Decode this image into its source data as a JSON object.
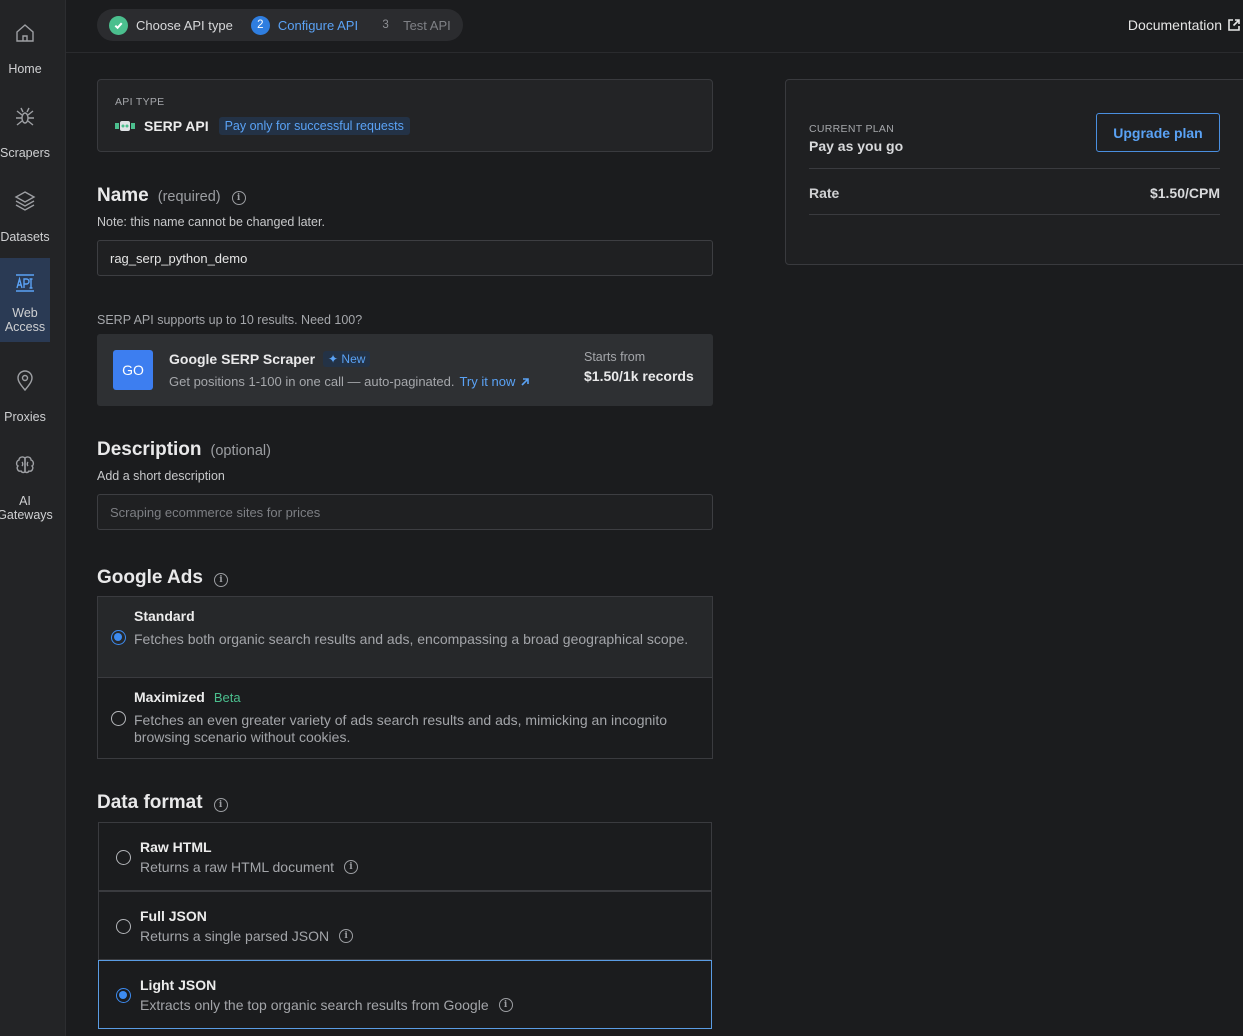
{
  "sidebar": {
    "items": [
      {
        "label": "Home",
        "icon": "home-icon"
      },
      {
        "label": "Scrapers",
        "icon": "spider-icon"
      },
      {
        "label": "Datasets",
        "icon": "layers-icon"
      },
      {
        "label": "Web\nAccess",
        "icon": "api-icon",
        "active": true
      },
      {
        "label": "Proxies",
        "icon": "location-pin-icon"
      },
      {
        "label": "AI\nGateways",
        "icon": "brain-icon"
      }
    ]
  },
  "stepper": {
    "steps": [
      {
        "number": "",
        "label": "Choose API type",
        "state": "done"
      },
      {
        "number": "2",
        "label": "Configure API",
        "state": "current"
      },
      {
        "number": "3",
        "label": "Test API",
        "state": "todo"
      }
    ]
  },
  "header": {
    "documentation": "Documentation"
  },
  "api_type": {
    "label": "API TYPE",
    "name": "SERP API",
    "badge": "Pay only for successful requests"
  },
  "name_section": {
    "title": "Name",
    "sub": "(required)",
    "note": "Note: this name cannot be changed later.",
    "value": "rag_serp_python_demo"
  },
  "promo": {
    "supports": "SERP API supports up to 10 results. Need 100?",
    "logo_text": "GO",
    "title": "Google SERP Scraper",
    "new_badge": "New",
    "desc": "Get positions 1-100 in one call — auto-paginated.",
    "try_link": "Try it now",
    "starts_from": "Starts from",
    "price": "$1.50/1k records"
  },
  "description_section": {
    "title": "Description",
    "sub": "(optional)",
    "note": "Add a short description",
    "placeholder": "Scraping ecommerce sites for prices"
  },
  "google_ads": {
    "title": "Google Ads",
    "options": [
      {
        "title": "Standard",
        "tag": "",
        "desc": "Fetches both organic search results and ads, encompassing a broad geographical scope.",
        "selected": true
      },
      {
        "title": "Maximized",
        "tag": "Beta",
        "desc": "Fetches an even greater variety of ads search results and ads, mimicking an incognito browsing scenario without cookies.",
        "selected": false
      }
    ]
  },
  "data_format": {
    "title": "Data format",
    "options": [
      {
        "title": "Raw HTML",
        "desc": "Returns a raw HTML document",
        "selected": false
      },
      {
        "title": "Full JSON",
        "desc": "Returns a single parsed JSON",
        "selected": false
      },
      {
        "title": "Light JSON",
        "desc": "Extracts only the top organic search results from Google",
        "selected": true
      }
    ]
  },
  "plan": {
    "label": "CURRENT PLAN",
    "name": "Pay as you go",
    "upgrade": "Upgrade plan",
    "rate_label": "Rate",
    "rate_value": "$1.50/CPM"
  },
  "colors": {
    "accent": "#3d8bf0",
    "success": "#4bbf8e",
    "background": "#1b1c1e"
  }
}
